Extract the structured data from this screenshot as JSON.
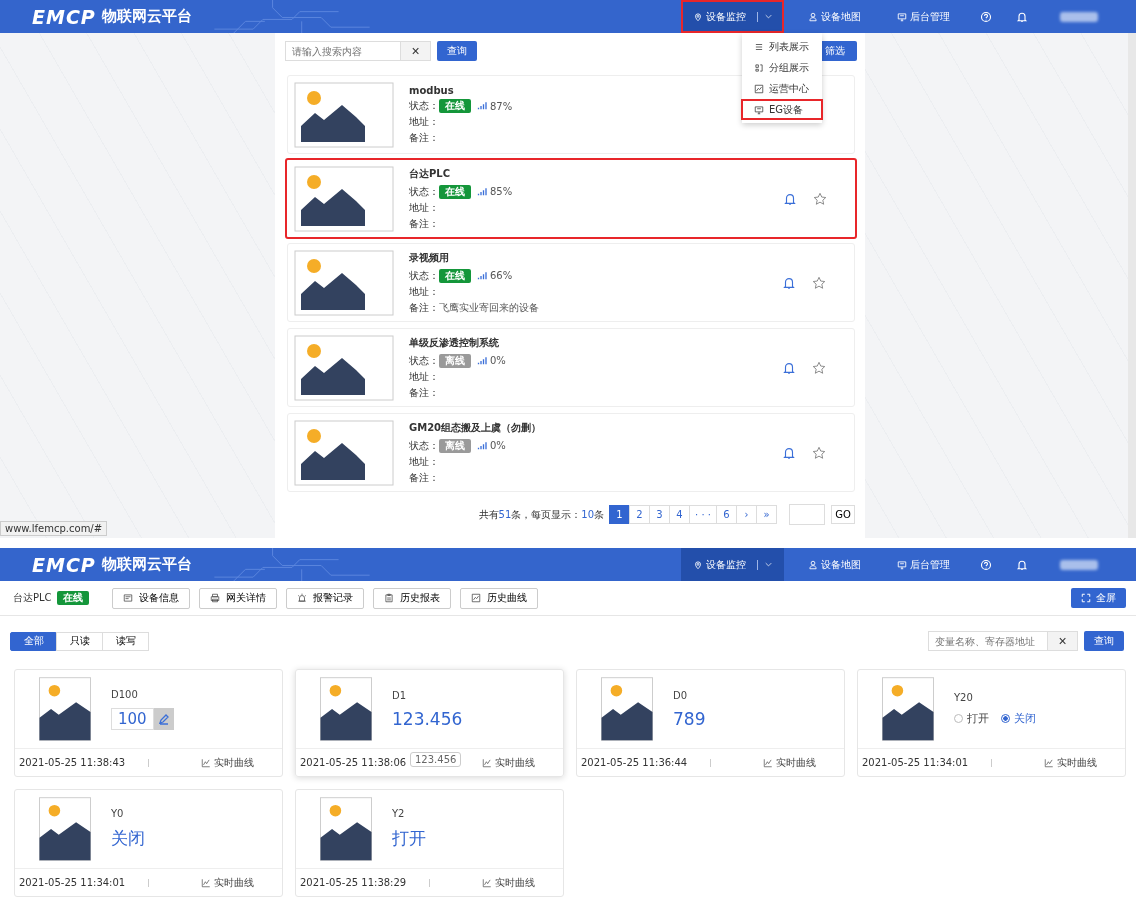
{
  "screens": [
    {
      "kind": "device_list",
      "header": {
        "logo": "EMCP",
        "title": "物联网云平台",
        "nav": [
          {
            "label": "设备监控",
            "selected": true,
            "highlighted": true,
            "dropdown": true
          },
          {
            "label": "设备地图",
            "selected": false,
            "highlighted": false,
            "dropdown": false
          },
          {
            "label": "后台管理",
            "selected": false,
            "highlighted": false,
            "dropdown": false
          }
        ]
      },
      "search": {
        "placeholder": "请输入搜索内容",
        "clear": "×",
        "button": "查询"
      },
      "filter_button": "筛选",
      "menu": [
        {
          "label": "列表展示",
          "highlighted": false
        },
        {
          "label": "分组展示",
          "highlighted": false
        },
        {
          "label": "运营中心",
          "highlighted": false
        },
        {
          "label": "EG设备",
          "highlighted": true
        }
      ],
      "devices": [
        {
          "name": "modbus",
          "status_label": "状态：",
          "status": "在线",
          "online": true,
          "signal": "87%",
          "address_label": "地址：",
          "note_label": "备注：",
          "highlighted": false,
          "actions": false
        },
        {
          "name": "台达PLC",
          "status_label": "状态：",
          "status": "在线",
          "online": true,
          "signal": "85%",
          "address_label": "地址：",
          "note_label": "备注：",
          "highlighted": true,
          "actions": true
        },
        {
          "name": "录视频用",
          "status_label": "状态：",
          "status": "在线",
          "online": true,
          "signal": "66%",
          "address_label": "地址：",
          "note_label": "备注：",
          "note": "飞鹰实业寄回来的设备",
          "highlighted": false,
          "actions": true
        },
        {
          "name": "单级反渗透控制系统",
          "status_label": "状态：",
          "status": "离线",
          "online": false,
          "signal": "0%",
          "address_label": "地址：",
          "note_label": "备注：",
          "highlighted": false,
          "actions": true
        },
        {
          "name": "GM20组态搬及上虞（勿删）",
          "status_label": "状态：",
          "status": "离线",
          "online": false,
          "signal": "0%",
          "address_label": "地址：",
          "note_label": "备注：",
          "highlighted": false,
          "actions": true
        }
      ],
      "pagination": {
        "total_prefix": "共有",
        "total": "51",
        "total_middle": "条，每页显示：",
        "per_page": "10",
        "per_page_suffix": "条",
        "pages": [
          {
            "label": "1",
            "selected": true
          },
          {
            "label": "2",
            "selected": false
          },
          {
            "label": "3",
            "selected": false
          },
          {
            "label": "4",
            "selected": false
          },
          {
            "label": "· · ·",
            "selected": false
          },
          {
            "label": "6",
            "selected": false
          },
          {
            "label": "›",
            "selected": false
          },
          {
            "label": "»",
            "selected": false
          }
        ],
        "go": "GO"
      },
      "status_url": "www.lfemcp.com/#"
    },
    {
      "kind": "device_detail",
      "header": {
        "logo": "EMCP",
        "title": "物联网云平台",
        "nav": [
          {
            "label": "设备监控",
            "selected": true,
            "highlighted": false,
            "dropdown": true
          },
          {
            "label": "设备地图",
            "selected": false,
            "highlighted": false,
            "dropdown": false
          },
          {
            "label": "后台管理",
            "selected": false,
            "highlighted": false,
            "dropdown": false
          }
        ]
      },
      "device": {
        "name": "台达PLC",
        "status": "在线"
      },
      "tools": [
        {
          "label": "设备信息"
        },
        {
          "label": "网关详情"
        },
        {
          "label": "报警记录"
        },
        {
          "label": "历史报表"
        },
        {
          "label": "历史曲线"
        }
      ],
      "fullscreen": "全屏",
      "tabs": [
        {
          "label": "全部",
          "selected": true
        },
        {
          "label": "只读",
          "selected": false
        },
        {
          "label": "读写",
          "selected": false
        }
      ],
      "search": {
        "placeholder": "变量名称、寄存器地址",
        "clear": "×",
        "button": "查询"
      },
      "variables": [
        {
          "name": "D100",
          "kind": "editable",
          "value": "100",
          "time": "2021-05-25 11:38:43",
          "link": "实时曲线"
        },
        {
          "name": "D1",
          "kind": "number",
          "value": "123.456",
          "tooltip": "123.456",
          "time": "2021-05-25 11:38:06",
          "link": "实时曲线"
        },
        {
          "name": "D0",
          "kind": "number",
          "value": "789",
          "time": "2021-05-25 11:36:44",
          "link": "实时曲线"
        },
        {
          "name": "Y20",
          "kind": "switch",
          "options": [
            {
              "label": "打开",
              "selected": false
            },
            {
              "label": "关闭",
              "selected": true
            }
          ],
          "time": "2021-05-25 11:34:01",
          "link": "实时曲线"
        },
        {
          "name": "Y0",
          "kind": "number",
          "value": "关闭",
          "time": "2021-05-25 11:34:01",
          "link": "实时曲线"
        },
        {
          "name": "Y2",
          "kind": "number",
          "value": "打开",
          "time": "2021-05-25 11:38:29",
          "link": "实时曲线"
        }
      ]
    }
  ]
}
